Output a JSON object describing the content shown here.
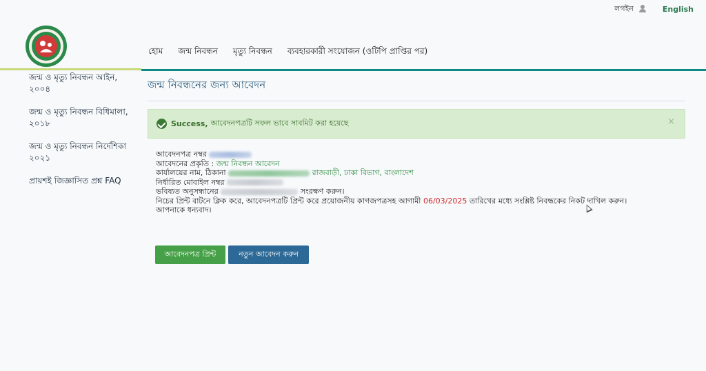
{
  "header": {
    "login_label": "লগইন",
    "language_label": "English"
  },
  "nav": {
    "items": [
      {
        "label": "হোম"
      },
      {
        "label": "জন্ম নিবন্ধন"
      },
      {
        "label": "মৃত্যু নিবন্ধন"
      },
      {
        "label": "ব্যবহারকারী সংযোজন (ওটিপি প্রাপ্তির পর)"
      }
    ]
  },
  "sidebar": {
    "items": [
      {
        "label": "জন্ম ও মৃত্যু নিবন্ধন আইন, ২০০৪"
      },
      {
        "label": "জন্ম ও মৃত্যু নিবন্ধন বিধিমালা, ২০১৮"
      },
      {
        "label": "জন্ম ও মৃত্যু নিবন্ধন নির্দেশিকা ২০২১"
      },
      {
        "label": "প্রায়শই জিজ্ঞাসিত প্রশ্ন FAQ"
      }
    ]
  },
  "main": {
    "title": "জন্ম নিবন্ধনের জন্য আবেদন",
    "alert": {
      "strong": "Success,",
      "message": "আবেদনপত্রটি সফল ভাবে সাবমিট করা হয়েছে",
      "close": "×"
    },
    "details": {
      "application_no_label": "আবেদনপত্র নম্বর",
      "application_type_label": "আবেদনের প্রকৃতি :",
      "application_type_value": "জন্ম নিবন্ধন আবেদন",
      "office_label": "কার্যালয়ের নাম, ঠিকানা",
      "office_value_visible": "রাজবাড়ী, ঢাকা বিভাগ, বাংলাদেশ",
      "mobile_label": "নির্ধারিত মোবাইল নম্বর",
      "future_ref_start": "ভবিষ্যত অনুসন্ধানের",
      "future_ref_end": "সংরক্ষণ করুন।",
      "instruction_start": "নিচের প্রিন্ট বাটনে ক্লিক করে, আবেদনপত্রটি প্রিন্ট করে প্রয়োজনীয় কাগজপত্রসহ আগামী",
      "deadline_date": "06/03/2025",
      "instruction_end": "তারিখের মধ্যে সংশ্লিষ্ট নিবন্ধকের নিকট দাখিল করুন।",
      "thanks": "আপনাকে ধন্যবাদ।"
    },
    "buttons": {
      "print_label": "আবেদনপত্র প্রিন্ট",
      "new_label": "নতুন আবেদন করুন"
    }
  },
  "colors": {
    "teal_rule": "#0d8a86",
    "success_bg": "#d8eccf",
    "print_button": "#46a047",
    "new_button": "#2d6996",
    "deadline_red": "#d22a2a"
  }
}
